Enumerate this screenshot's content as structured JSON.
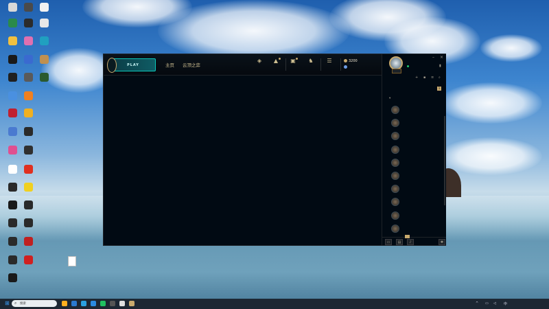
{
  "desktop": {
    "icons": [
      {
        "label": "",
        "color": "#d8d8d8"
      },
      {
        "label": "",
        "color": "#4a4a4a"
      },
      {
        "label": "",
        "color": "#f2f2f2"
      },
      {
        "label": "",
        "color": "#2a8a4a"
      },
      {
        "label": "",
        "color": "#2b2b2b"
      },
      {
        "label": "",
        "color": "#e8e8e8"
      },
      {
        "label": "",
        "color": "#f0c040"
      },
      {
        "label": "",
        "color": "#e070b0"
      },
      {
        "label": "",
        "color": "#20a0c0"
      },
      {
        "label": "",
        "color": "#1a1a1a"
      },
      {
        "label": "",
        "color": "#3a6ad0"
      },
      {
        "label": "",
        "color": "#c09050"
      },
      {
        "label": "",
        "color": "#202020"
      },
      {
        "label": "",
        "color": "#5a5a5a"
      },
      {
        "label": "",
        "color": "#2a5a30"
      },
      {
        "label": "",
        "color": "#4a90e0"
      },
      {
        "label": "",
        "color": "#f08020"
      },
      {
        "label": "",
        "color": "#c02030"
      },
      {
        "label": "",
        "color": "#f0b020"
      },
      {
        "label": "",
        "color": "#4a7ad0"
      },
      {
        "label": "",
        "color": "#2a2a2a"
      },
      {
        "label": "",
        "color": "#e05090"
      },
      {
        "label": "",
        "color": "#303030"
      },
      {
        "label": "",
        "color": "#ffffff"
      },
      {
        "label": "",
        "color": "#e03020"
      },
      {
        "label": "",
        "color": "#2a2a2a"
      },
      {
        "label": "",
        "color": "#f0d020"
      },
      {
        "label": "",
        "color": "#1a1a1a"
      },
      {
        "label": "",
        "color": "#2a2a2a"
      },
      {
        "label": "",
        "color": "#2a2a2a"
      },
      {
        "label": "",
        "color": "#2a2a2a"
      },
      {
        "label": "",
        "color": "#2a2a2a"
      },
      {
        "label": "",
        "color": "#c02020"
      },
      {
        "label": "",
        "color": "#2a2a2a"
      },
      {
        "label": "",
        "color": "#d02020"
      },
      {
        "label": "",
        "color": "#1a1a1a"
      }
    ],
    "file_label": ""
  },
  "client": {
    "play_label": "PLAY",
    "nav": {
      "home": "主页",
      "tft": "云顶之弈"
    },
    "top_icons": [
      {
        "icon": "◈",
        "label": ""
      },
      {
        "icon": "▲",
        "label": ""
      },
      {
        "icon": "▣",
        "label": ""
      },
      {
        "icon": "♞",
        "label": ""
      },
      {
        "icon": "☰",
        "label": ""
      }
    ],
    "currency": {
      "be": "3200",
      "rp": ""
    },
    "profile": {
      "name": "",
      "status": "",
      "level": ""
    },
    "social": {
      "header": "",
      "requests_label": "",
      "requests_count": "1",
      "group_label": "",
      "friends": [
        {
          "name": "",
          "status": ""
        },
        {
          "name": "",
          "status": ""
        },
        {
          "name": "",
          "status": ""
        },
        {
          "name": "",
          "status": ""
        },
        {
          "name": "",
          "status": ""
        },
        {
          "name": "",
          "status": ""
        },
        {
          "name": "",
          "status": ""
        },
        {
          "name": "",
          "status": ""
        },
        {
          "name": "",
          "status": ""
        },
        {
          "name": "",
          "status": ""
        }
      ],
      "footer_badge": "",
      "version": ""
    }
  },
  "taskbar": {
    "search_placeholder": "搜索"
  },
  "colors": {
    "gold": "#c8aa6e",
    "teal": "#0ac8b9",
    "online": "#1ecc6e"
  }
}
